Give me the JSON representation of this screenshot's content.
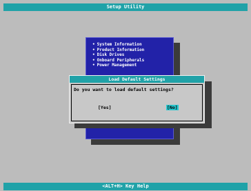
{
  "title_bar": {
    "text": "Setup Utility"
  },
  "footer_bar": {
    "text": "<ALT+H>  Key Help"
  },
  "menu": {
    "bullet": "•",
    "items": [
      "System Information",
      "Product Information",
      "Disk Drives",
      "Onboard Peripherals",
      "Power Management"
    ]
  },
  "dialog": {
    "title": "Load Default Settings",
    "question": "Do you want to load default settings?",
    "yes_label": "[Yes]",
    "no_label": "[No]",
    "selected": "No"
  },
  "colors": {
    "background": "#bcbcbc",
    "bar_cyan": "#20a2a8",
    "menu_blue": "#2222a8",
    "shadow": "#3b3b3b",
    "dialog_gray": "#c8c8c8",
    "highlight": "#28c8d0"
  }
}
